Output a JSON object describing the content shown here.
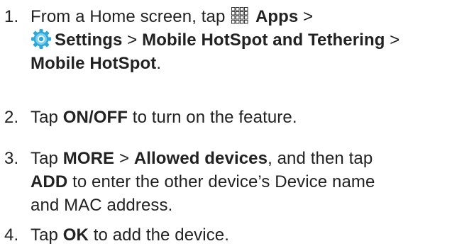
{
  "steps": [
    {
      "number": "1.",
      "t1": "From a Home screen, tap ",
      "apps": "Apps",
      "t2": " >",
      "settings": "Settings",
      "t3": " > ",
      "hotspot_tethering": "Mobile HotSpot and Tethering",
      "t4": " >",
      "hotspot": "Mobile HotSpot",
      "t5": "."
    },
    {
      "number": "2.",
      "t1": "Tap ",
      "onoff": "ON/OFF",
      "t2": " to turn on the feature."
    },
    {
      "number": "3.",
      "t1": "Tap ",
      "more": "MORE",
      "t2": " > ",
      "allowed": "Allowed devices",
      "t3": ", and then tap",
      "add": "ADD",
      "t4": " to enter the other device’s Device name",
      "t5": "and MAC address."
    },
    {
      "number": "4.",
      "t1": "Tap ",
      "ok": "OK",
      "t2": " to add the device."
    }
  ],
  "icons": {
    "apps": "apps-grid-icon",
    "settings": "settings-gear-icon"
  },
  "colors": {
    "text": "#222222",
    "settings_icon_outer": "#2FA8D8",
    "settings_icon_inner": "#7AD0EE"
  }
}
